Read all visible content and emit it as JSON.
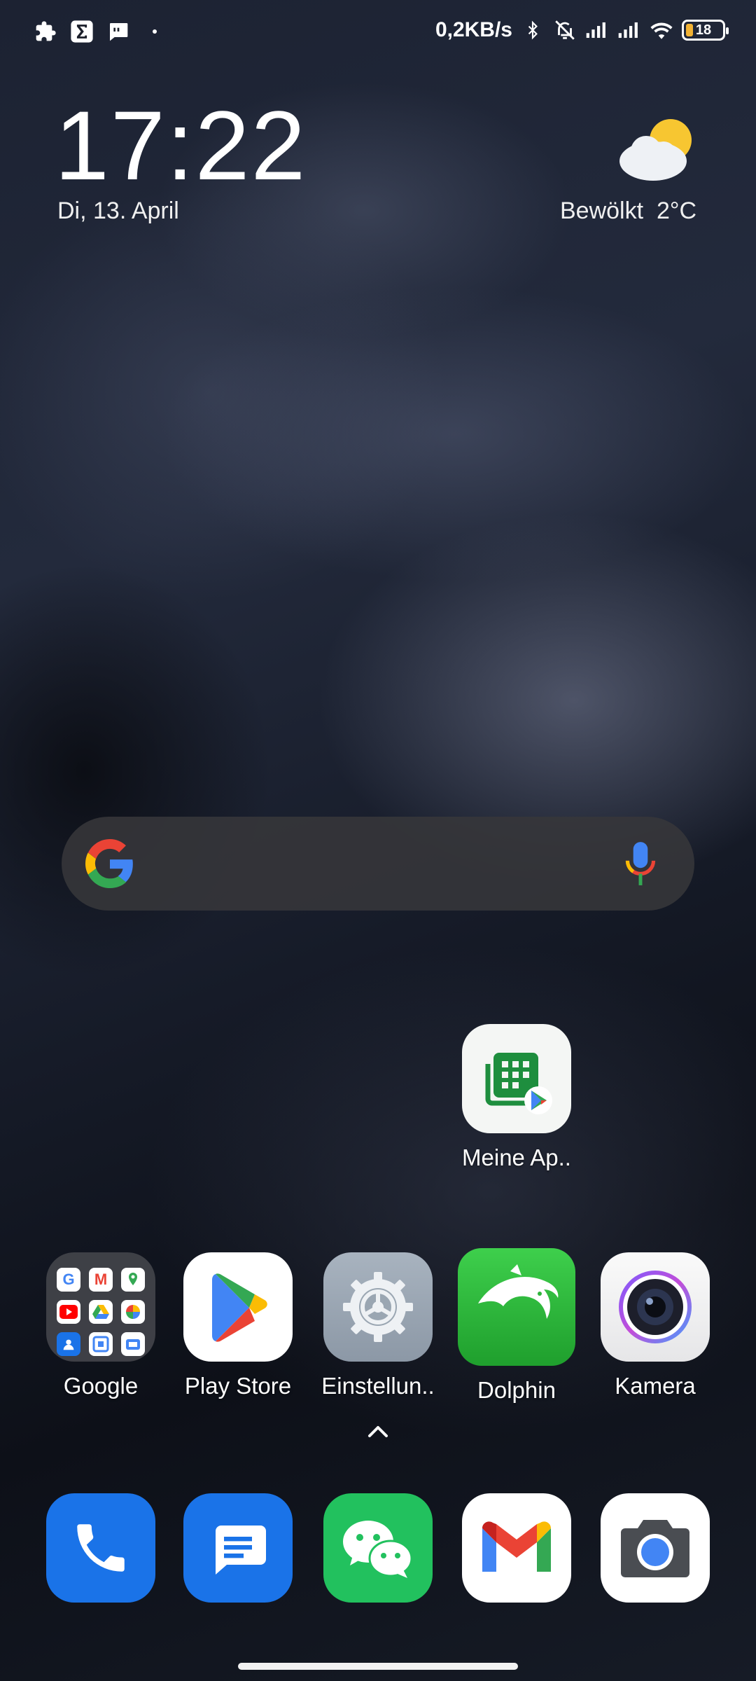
{
  "status_bar": {
    "net_speed": "0,2KB/s",
    "battery": "18",
    "left_icons": [
      "puzzle-icon",
      "sigma-icon",
      "message-notification-icon",
      "dot-icon"
    ],
    "right_icons": [
      "bluetooth-icon",
      "alarm-off-icon",
      "signal-icon",
      "signal-icon",
      "wifi-icon",
      "battery-icon"
    ]
  },
  "clock_widget": {
    "time": "17:22",
    "date": "Di, 13. April"
  },
  "weather_widget": {
    "condition": "Bewölkt",
    "temperature": "2°C",
    "icon": "partly-cloudy-icon"
  },
  "search_bar": {
    "logo": "google-logo",
    "mic": "mic-icon"
  },
  "home_apps": [
    {
      "label": "Meine Ap..",
      "icon": "meine-apps-icon"
    }
  ],
  "app_row": [
    {
      "label": "Google",
      "icon": "google-folder-icon"
    },
    {
      "label": "Play Store",
      "icon": "play-store-icon"
    },
    {
      "label": "Einstellun..",
      "icon": "settings-icon"
    },
    {
      "label": "Dolphin",
      "icon": "dolphin-icon"
    },
    {
      "label": "Kamera",
      "icon": "camera-icon"
    }
  ],
  "dock": [
    {
      "icon": "phone-icon"
    },
    {
      "icon": "messages-icon"
    },
    {
      "icon": "wechat-icon"
    },
    {
      "icon": "gmail-icon"
    },
    {
      "icon": "google-camera-icon"
    }
  ],
  "colors": {
    "phone_blue": "#1a73e8",
    "messages_blue": "#1a73e8",
    "wechat_green": "#22c15e",
    "dolphin_green": "#2fb63c",
    "settings_gray": "#9aa6b2",
    "battery_yellow": "#f2b233"
  }
}
